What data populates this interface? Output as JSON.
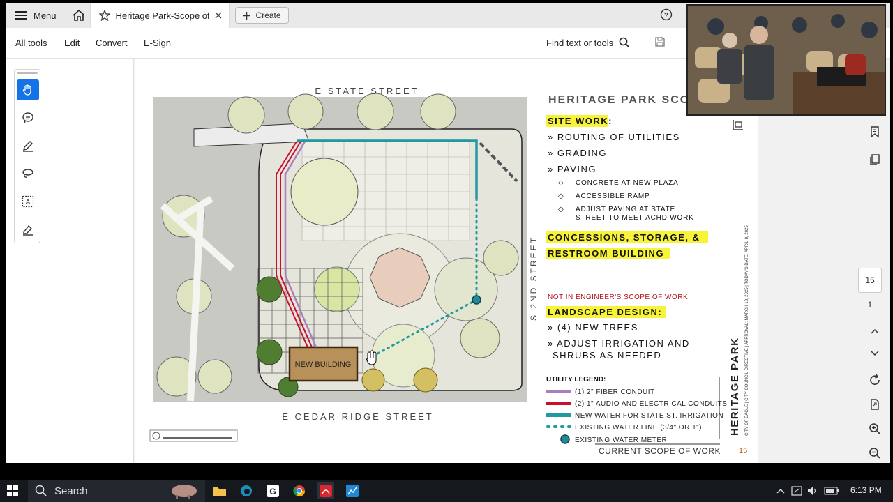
{
  "titlebar": {
    "menu_label": "Menu",
    "tab_title": "Heritage Park-Scope of ...",
    "create_label": "Create"
  },
  "toolbar": {
    "all_tools": "All tools",
    "edit": "Edit",
    "convert": "Convert",
    "esign": "E-Sign",
    "find_label": "Find text or tools"
  },
  "page_nav": {
    "current": "15",
    "total": "1"
  },
  "sheet": {
    "street_top": "E STATE STREET",
    "street_bottom": "E CEDAR RIDGE STREET",
    "street_right": "S 2ND STREET",
    "new_building": "NEW BUILDING",
    "title": "HERITAGE PARK SCO",
    "site_work": "SITE WORK:",
    "site_items": [
      "» ROUTING OF UTILITIES",
      "» GRADING",
      "» PAVING"
    ],
    "paving_items": [
      "CONCRETE AT NEW PLAZA",
      "ACCESSIBLE RAMP",
      "ADJUST PAVING AT STATE",
      "STREET TO MEET ACHD WORK"
    ],
    "concessions_1": "CONCESSIONS, STORAGE, &",
    "concessions_2": "RESTROOM BUILDING",
    "not_in_scope": "NOT IN ENGINEER'S SCOPE OF WORK:",
    "landscape": "LANDSCAPE DESIGN:",
    "landscape_items": [
      "» (4) NEW TREES",
      "» ADJUST IRRIGATION AND",
      "SHRUBS AS NEEDED"
    ],
    "legend_title": "UTILITY LEGEND:",
    "legend": [
      {
        "label": "(1) 2\" FIBER CONDUIT",
        "color": "#a77fc0"
      },
      {
        "label": "(2) 1\" AUDIO AND ELECTRICAL CONDUITS",
        "color": "#c8102e"
      },
      {
        "label": "NEW WATER FOR STATE ST. IRRIGATION",
        "color": "#1f9aa3"
      },
      {
        "label": "EXISTING WATER LINE (3/4\" OR 1\")",
        "color": "#1f9aa3"
      },
      {
        "label": "EXISTING WATER METER",
        "color": "#1f8a93"
      }
    ],
    "vertical_title": "HERITAGE PARK",
    "vertical_sub": "CITY OF EAGLE | CITY COUNCIL DIRECTIVE | APPROVAL: MARCH 18, 2025 | TODAY'S DATE: APRIL 8, 2025",
    "footer": "CURRENT SCOPE OF WORK",
    "page_number": "15"
  },
  "taskbar": {
    "search": "Search",
    "time": "6:13 PM"
  },
  "colors": {
    "accent": "#1473e6",
    "highlight": "#f7f338",
    "water": "#1f9aa3",
    "conduit_red": "#c8102e",
    "fiber_purple": "#a77fc0",
    "building": "#b8915a"
  }
}
